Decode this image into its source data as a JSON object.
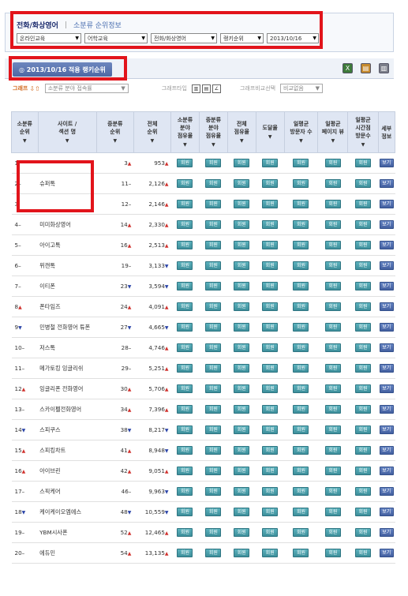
{
  "filter": {
    "title": "전화/화상영어",
    "separator": "|",
    "link": "소분류 순위정보",
    "selects": [
      {
        "name": "select-category-1",
        "value": "온라인교육"
      },
      {
        "name": "select-category-2",
        "value": "어학교육"
      },
      {
        "name": "select-category-3",
        "value": "전화/화상영어"
      },
      {
        "name": "select-ranking-type",
        "value": "랭키순위"
      },
      {
        "name": "select-date",
        "value": "2013/10/16"
      }
    ]
  },
  "date_bar": {
    "tab_label": "◎ 2013/10/16 적용 랭키순위",
    "icons": [
      "excel-icon",
      "save-icon",
      "print-icon"
    ]
  },
  "graph_row": {
    "label": "그래프",
    "select1_value": "소분류 분야 접속률",
    "graph_type_label": "그래프타입",
    "compare_label": "그래프비교선택",
    "compare_value": "비교없음"
  },
  "table": {
    "headers": [
      [
        "소분류",
        "순위"
      ],
      [
        "사이트 /",
        "섹션 명"
      ],
      [
        "중분류",
        "순위"
      ],
      [
        "전체",
        "순위"
      ],
      [
        "소분류",
        "분야",
        "점유율"
      ],
      [
        "중분류",
        "분야",
        "점유율"
      ],
      [
        "전체",
        "점유율"
      ],
      [
        "도달율"
      ],
      [
        "일평균",
        "방문자 수"
      ],
      [
        "일평균",
        "페이지 뷰"
      ],
      [
        "일평균",
        "시간점",
        "방문수"
      ],
      [
        "세부",
        "정보"
      ]
    ],
    "member_label": "회원",
    "view_label": "보기",
    "rows": [
      {
        "rank": "1",
        "trend": "",
        "site": "",
        "cat_rank": "3",
        "cat_trend": "up",
        "all_rank": "953",
        "all_trend": "up"
      },
      {
        "rank": "2",
        "trend": "-",
        "site": "슈퍼톡",
        "cat_rank": "11",
        "cat_trend": "-",
        "all_rank": "2,126",
        "all_trend": "up"
      },
      {
        "rank": "3",
        "trend": "",
        "site": "",
        "cat_rank": "12",
        "cat_trend": "-",
        "all_rank": "2,146",
        "all_trend": "up"
      },
      {
        "rank": "4",
        "trend": "-",
        "site": "미미화상영어",
        "cat_rank": "14",
        "cat_trend": "up",
        "all_rank": "2,330",
        "all_trend": "up"
      },
      {
        "rank": "5",
        "trend": "-",
        "site": "아이고톡",
        "cat_rank": "16",
        "cat_trend": "up",
        "all_rank": "2,513",
        "all_trend": "up"
      },
      {
        "rank": "6",
        "trend": "-",
        "site": "위캔톡",
        "cat_rank": "19",
        "cat_trend": "-",
        "all_rank": "3,133",
        "all_trend": "down"
      },
      {
        "rank": "7",
        "trend": "-",
        "site": "이티폰",
        "cat_rank": "23",
        "cat_trend": "down",
        "all_rank": "3,594",
        "all_trend": "down"
      },
      {
        "rank": "8",
        "trend": "up",
        "site": "폰타임즈",
        "cat_rank": "24",
        "cat_trend": "up",
        "all_rank": "4,091",
        "all_trend": "up"
      },
      {
        "rank": "9",
        "trend": "down",
        "site": "민병철 전화영어 튜폰",
        "cat_rank": "27",
        "cat_trend": "down",
        "all_rank": "4,665",
        "all_trend": "down"
      },
      {
        "rank": "10",
        "trend": "-",
        "site": "저스톡",
        "cat_rank": "28",
        "cat_trend": "-",
        "all_rank": "4,746",
        "all_trend": "up"
      },
      {
        "rank": "11",
        "trend": "-",
        "site": "메가토킹 잉글리쉬",
        "cat_rank": "29",
        "cat_trend": "-",
        "all_rank": "5,251",
        "all_trend": "up"
      },
      {
        "rank": "12",
        "trend": "up",
        "site": "잉글리폰 전화영어",
        "cat_rank": "30",
        "cat_trend": "up",
        "all_rank": "5,706",
        "all_trend": "up"
      },
      {
        "rank": "13",
        "trend": "-",
        "site": "스카이펠전화영어",
        "cat_rank": "34",
        "cat_trend": "up",
        "all_rank": "7,396",
        "all_trend": "up"
      },
      {
        "rank": "14",
        "trend": "down",
        "site": "스피쿠스",
        "cat_rank": "38",
        "cat_trend": "down",
        "all_rank": "8,217",
        "all_trend": "down"
      },
      {
        "rank": "15",
        "trend": "up",
        "site": "스피킹차트",
        "cat_rank": "41",
        "cat_trend": "up",
        "all_rank": "8,948",
        "all_trend": "down"
      },
      {
        "rank": "16",
        "trend": "up",
        "site": "아이브린",
        "cat_rank": "42",
        "cat_trend": "up",
        "all_rank": "9,051",
        "all_trend": "up"
      },
      {
        "rank": "17",
        "trend": "-",
        "site": "스픽케어",
        "cat_rank": "46",
        "cat_trend": "-",
        "all_rank": "9,963",
        "all_trend": "down"
      },
      {
        "rank": "18",
        "trend": "down",
        "site": "케이케이오엠에스",
        "cat_rank": "48",
        "cat_trend": "down",
        "all_rank": "10,559",
        "all_trend": "down"
      },
      {
        "rank": "19",
        "trend": "-",
        "site": "YBM시사폰",
        "cat_rank": "52",
        "cat_trend": "up",
        "all_rank": "12,465",
        "all_trend": "up"
      },
      {
        "rank": "20",
        "trend": "-",
        "site": "에듀민",
        "cat_rank": "54",
        "cat_trend": "up",
        "all_rank": "13,135",
        "all_trend": "up"
      }
    ]
  },
  "colors": {
    "highlight_red": "#e2141b",
    "member_button": "#3d8f9b",
    "view_button": "#4360a0",
    "header_bg": "#dfe6f3",
    "trend_up": "#d0312d",
    "trend_down": "#2a44a8"
  }
}
